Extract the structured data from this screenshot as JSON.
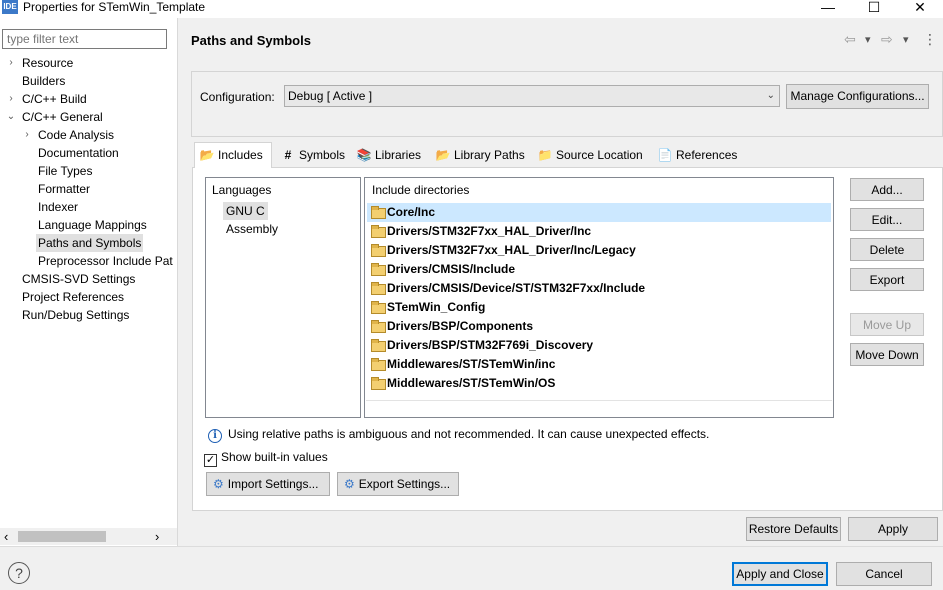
{
  "window": {
    "app_icon": "IDE",
    "title": "Properties for STemWin_Template",
    "minimize": "—",
    "maximize": "☐",
    "close": "✕"
  },
  "sidebar": {
    "filter_placeholder": "type filter text",
    "items": [
      {
        "label": "Resource",
        "toggle": "›"
      },
      {
        "label": "Builders",
        "toggle": ""
      },
      {
        "label": "C/C++ Build",
        "toggle": "›"
      },
      {
        "label": "C/C++ General",
        "toggle": "⌄"
      },
      {
        "label": "Code Analysis",
        "toggle": "›"
      },
      {
        "label": "Documentation",
        "toggle": ""
      },
      {
        "label": "File Types",
        "toggle": ""
      },
      {
        "label": "Formatter",
        "toggle": ""
      },
      {
        "label": "Indexer",
        "toggle": ""
      },
      {
        "label": "Language Mappings",
        "toggle": ""
      },
      {
        "label": "Paths and Symbols",
        "toggle": ""
      },
      {
        "label": "Preprocessor Include Pat",
        "toggle": ""
      },
      {
        "label": "CMSIS-SVD Settings",
        "toggle": ""
      },
      {
        "label": "Project References",
        "toggle": ""
      },
      {
        "label": "Run/Debug Settings",
        "toggle": ""
      }
    ],
    "selected": "Paths and Symbols",
    "scroll_left": "‹",
    "scroll_right": "›"
  },
  "page": {
    "title": "Paths and Symbols",
    "nav_back_icon": "⇦",
    "nav_forward_icon": "⇨",
    "menu_icon": "⋮",
    "dropdown_glyph": "▾"
  },
  "configuration": {
    "label": "Configuration:",
    "value": "Debug  [ Active ]",
    "manage_button": "Manage Configurations..."
  },
  "tabs": [
    {
      "label": "Includes",
      "icon": "📂"
    },
    {
      "label": "Symbols",
      "icon": "#"
    },
    {
      "label": "Libraries",
      "icon": "📚"
    },
    {
      "label": "Library Paths",
      "icon": "📂"
    },
    {
      "label": "Source Location",
      "icon": "📁"
    },
    {
      "label": "References",
      "icon": "📄"
    }
  ],
  "active_tab": "Includes",
  "languages": {
    "header": "Languages",
    "items": [
      "GNU C",
      "Assembly"
    ],
    "selected": "GNU C"
  },
  "include_dirs": {
    "header": "Include directories",
    "items": [
      "Core/Inc",
      "Drivers/STM32F7xx_HAL_Driver/Inc",
      "Drivers/STM32F7xx_HAL_Driver/Inc/Legacy",
      "Drivers/CMSIS/Include",
      "Drivers/CMSIS/Device/ST/STM32F7xx/Include",
      "STemWin_Config",
      "Drivers/BSP/Components",
      "Drivers/BSP/STM32F769i_Discovery",
      "Middlewares/ST/STemWin/inc",
      "Middlewares/ST/STemWin/OS"
    ],
    "selected": "Core/Inc"
  },
  "side_buttons": {
    "add": "Add...",
    "edit": "Edit...",
    "delete": "Delete",
    "export": "Export",
    "move_up": "Move Up",
    "move_down": "Move Down"
  },
  "info_message": "Using relative paths is ambiguous and not recommended. It can cause unexpected effects.",
  "info_icon": "i",
  "show_builtin": {
    "label": "Show built-in values",
    "checked": true,
    "mark": "✓"
  },
  "settings_buttons": {
    "import": "Import Settings...",
    "export": "Export Settings..."
  },
  "footer": {
    "restore_defaults": "Restore Defaults",
    "apply": "Apply",
    "apply_and_close": "Apply and Close",
    "cancel": "Cancel",
    "help_icon": "?"
  },
  "colors": {
    "selection": "#cce8ff",
    "accent": "#0078d7",
    "info": "#1e5fb4"
  }
}
